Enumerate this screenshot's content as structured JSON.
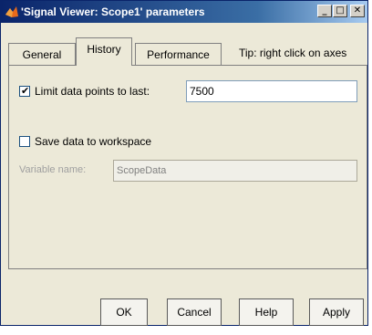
{
  "window": {
    "title": "'Signal Viewer: Scope1' parameters",
    "minimize": "_",
    "maximize": "□",
    "close": "✕",
    "icon": "matlab-logo-icon"
  },
  "tabs": [
    {
      "label": "General",
      "selected": false
    },
    {
      "label": "History",
      "selected": true
    },
    {
      "label": "Performance",
      "selected": false
    }
  ],
  "tip": "Tip: right click on axes",
  "history": {
    "limit_checked": true,
    "limit_label": "Limit data points to last:",
    "limit_value": "7500",
    "save_checked": false,
    "save_label": "Save data to workspace",
    "variable_label": "Variable name:",
    "variable_value": "ScopeData"
  },
  "buttons": {
    "ok": "OK",
    "cancel": "Cancel",
    "help": "Help",
    "apply": "Apply"
  },
  "colors": {
    "titlebar_start": "#0a246a",
    "titlebar_end": "#a6caf0",
    "face": "#ece9d8"
  }
}
